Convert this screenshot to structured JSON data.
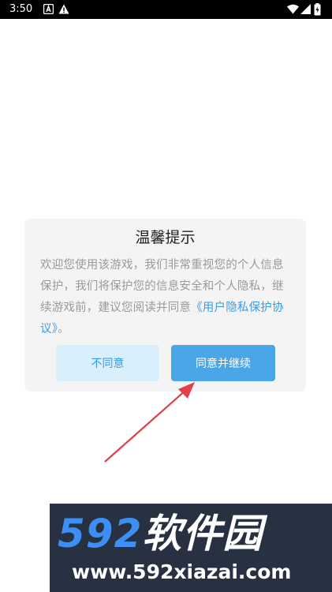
{
  "statusbar": {
    "time": "3:50",
    "left_icons": [
      "notification-a-icon",
      "warning-icon"
    ],
    "right_icons": [
      "wifi-icon",
      "signal-icon",
      "battery-icon"
    ]
  },
  "dialog": {
    "title": "温馨提示",
    "message_text": "欢迎您使用该游戏，我们非常重视您的个人信息保护，我们将保护您的信息安全和个人隐私，继续游戏前，建议您阅读并同意",
    "policy_link": "《用户隐私保护协议》",
    "message_end": "。",
    "disagree_label": "不同意",
    "agree_label": "同意并继续"
  },
  "watermark": {
    "logo_number": "592",
    "logo_text": "软件园",
    "url": "www.592xiazai.com"
  },
  "colors": {
    "accent": "#4aa6e6",
    "link": "#3c9be0",
    "arrow": "#e0404a"
  }
}
